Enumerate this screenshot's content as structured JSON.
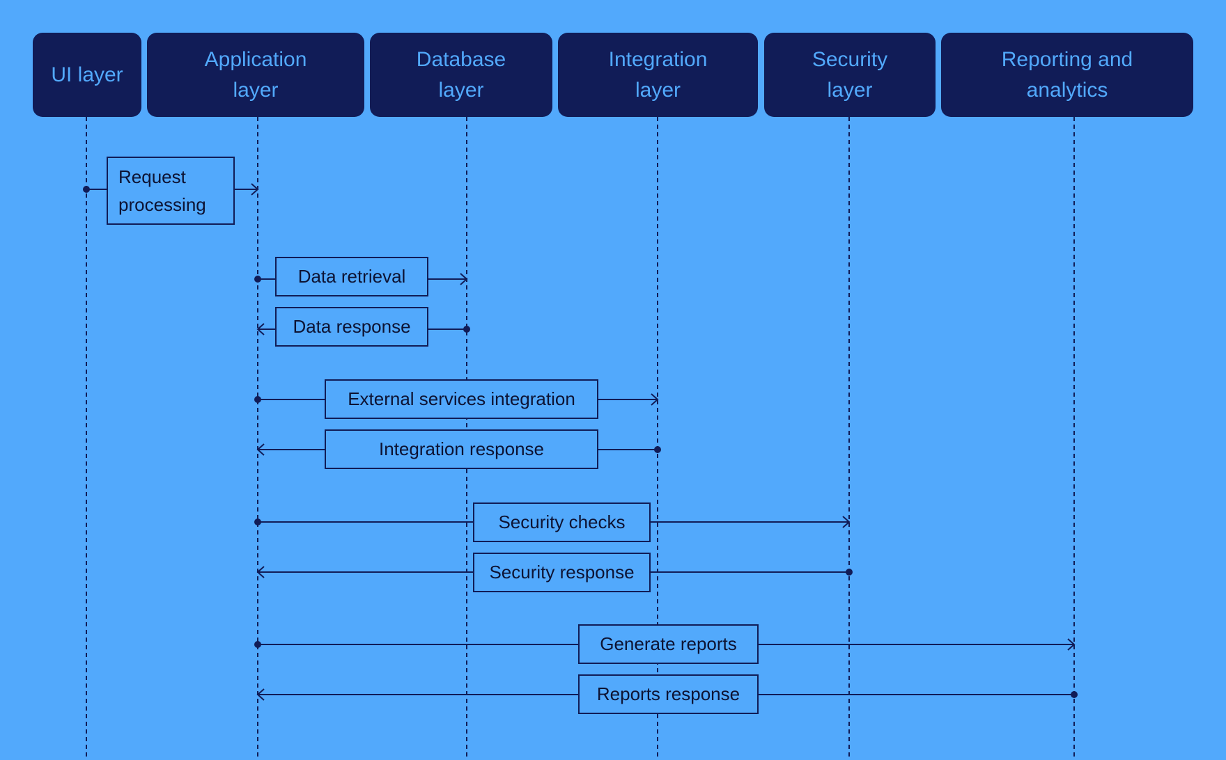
{
  "diagram": {
    "type": "sequence",
    "colors": {
      "background": "#52a9fc",
      "header_fill": "#111c57",
      "header_text": "#52a9fc",
      "line": "#111c57",
      "label_text": "#0d1333"
    },
    "participants": [
      {
        "id": "ui",
        "label": "UI layer"
      },
      {
        "id": "app",
        "label": "Application layer"
      },
      {
        "id": "db",
        "label": "Database layer"
      },
      {
        "id": "int",
        "label": "Integration layer"
      },
      {
        "id": "sec",
        "label": "Security layer"
      },
      {
        "id": "rep",
        "label": "Reporting and analytics"
      }
    ],
    "messages": [
      {
        "label": "Request processing",
        "from": "ui",
        "to": "app"
      },
      {
        "label": "Data retrieval",
        "from": "app",
        "to": "db"
      },
      {
        "label": "Data response",
        "from": "db",
        "to": "app"
      },
      {
        "label": "External services integration",
        "from": "app",
        "to": "int"
      },
      {
        "label": "Integration response",
        "from": "int",
        "to": "app"
      },
      {
        "label": "Security checks",
        "from": "app",
        "to": "sec"
      },
      {
        "label": "Security response",
        "from": "sec",
        "to": "app"
      },
      {
        "label": "Generate reports",
        "from": "app",
        "to": "rep"
      },
      {
        "label": "Reports response",
        "from": "rep",
        "to": "app"
      }
    ]
  }
}
